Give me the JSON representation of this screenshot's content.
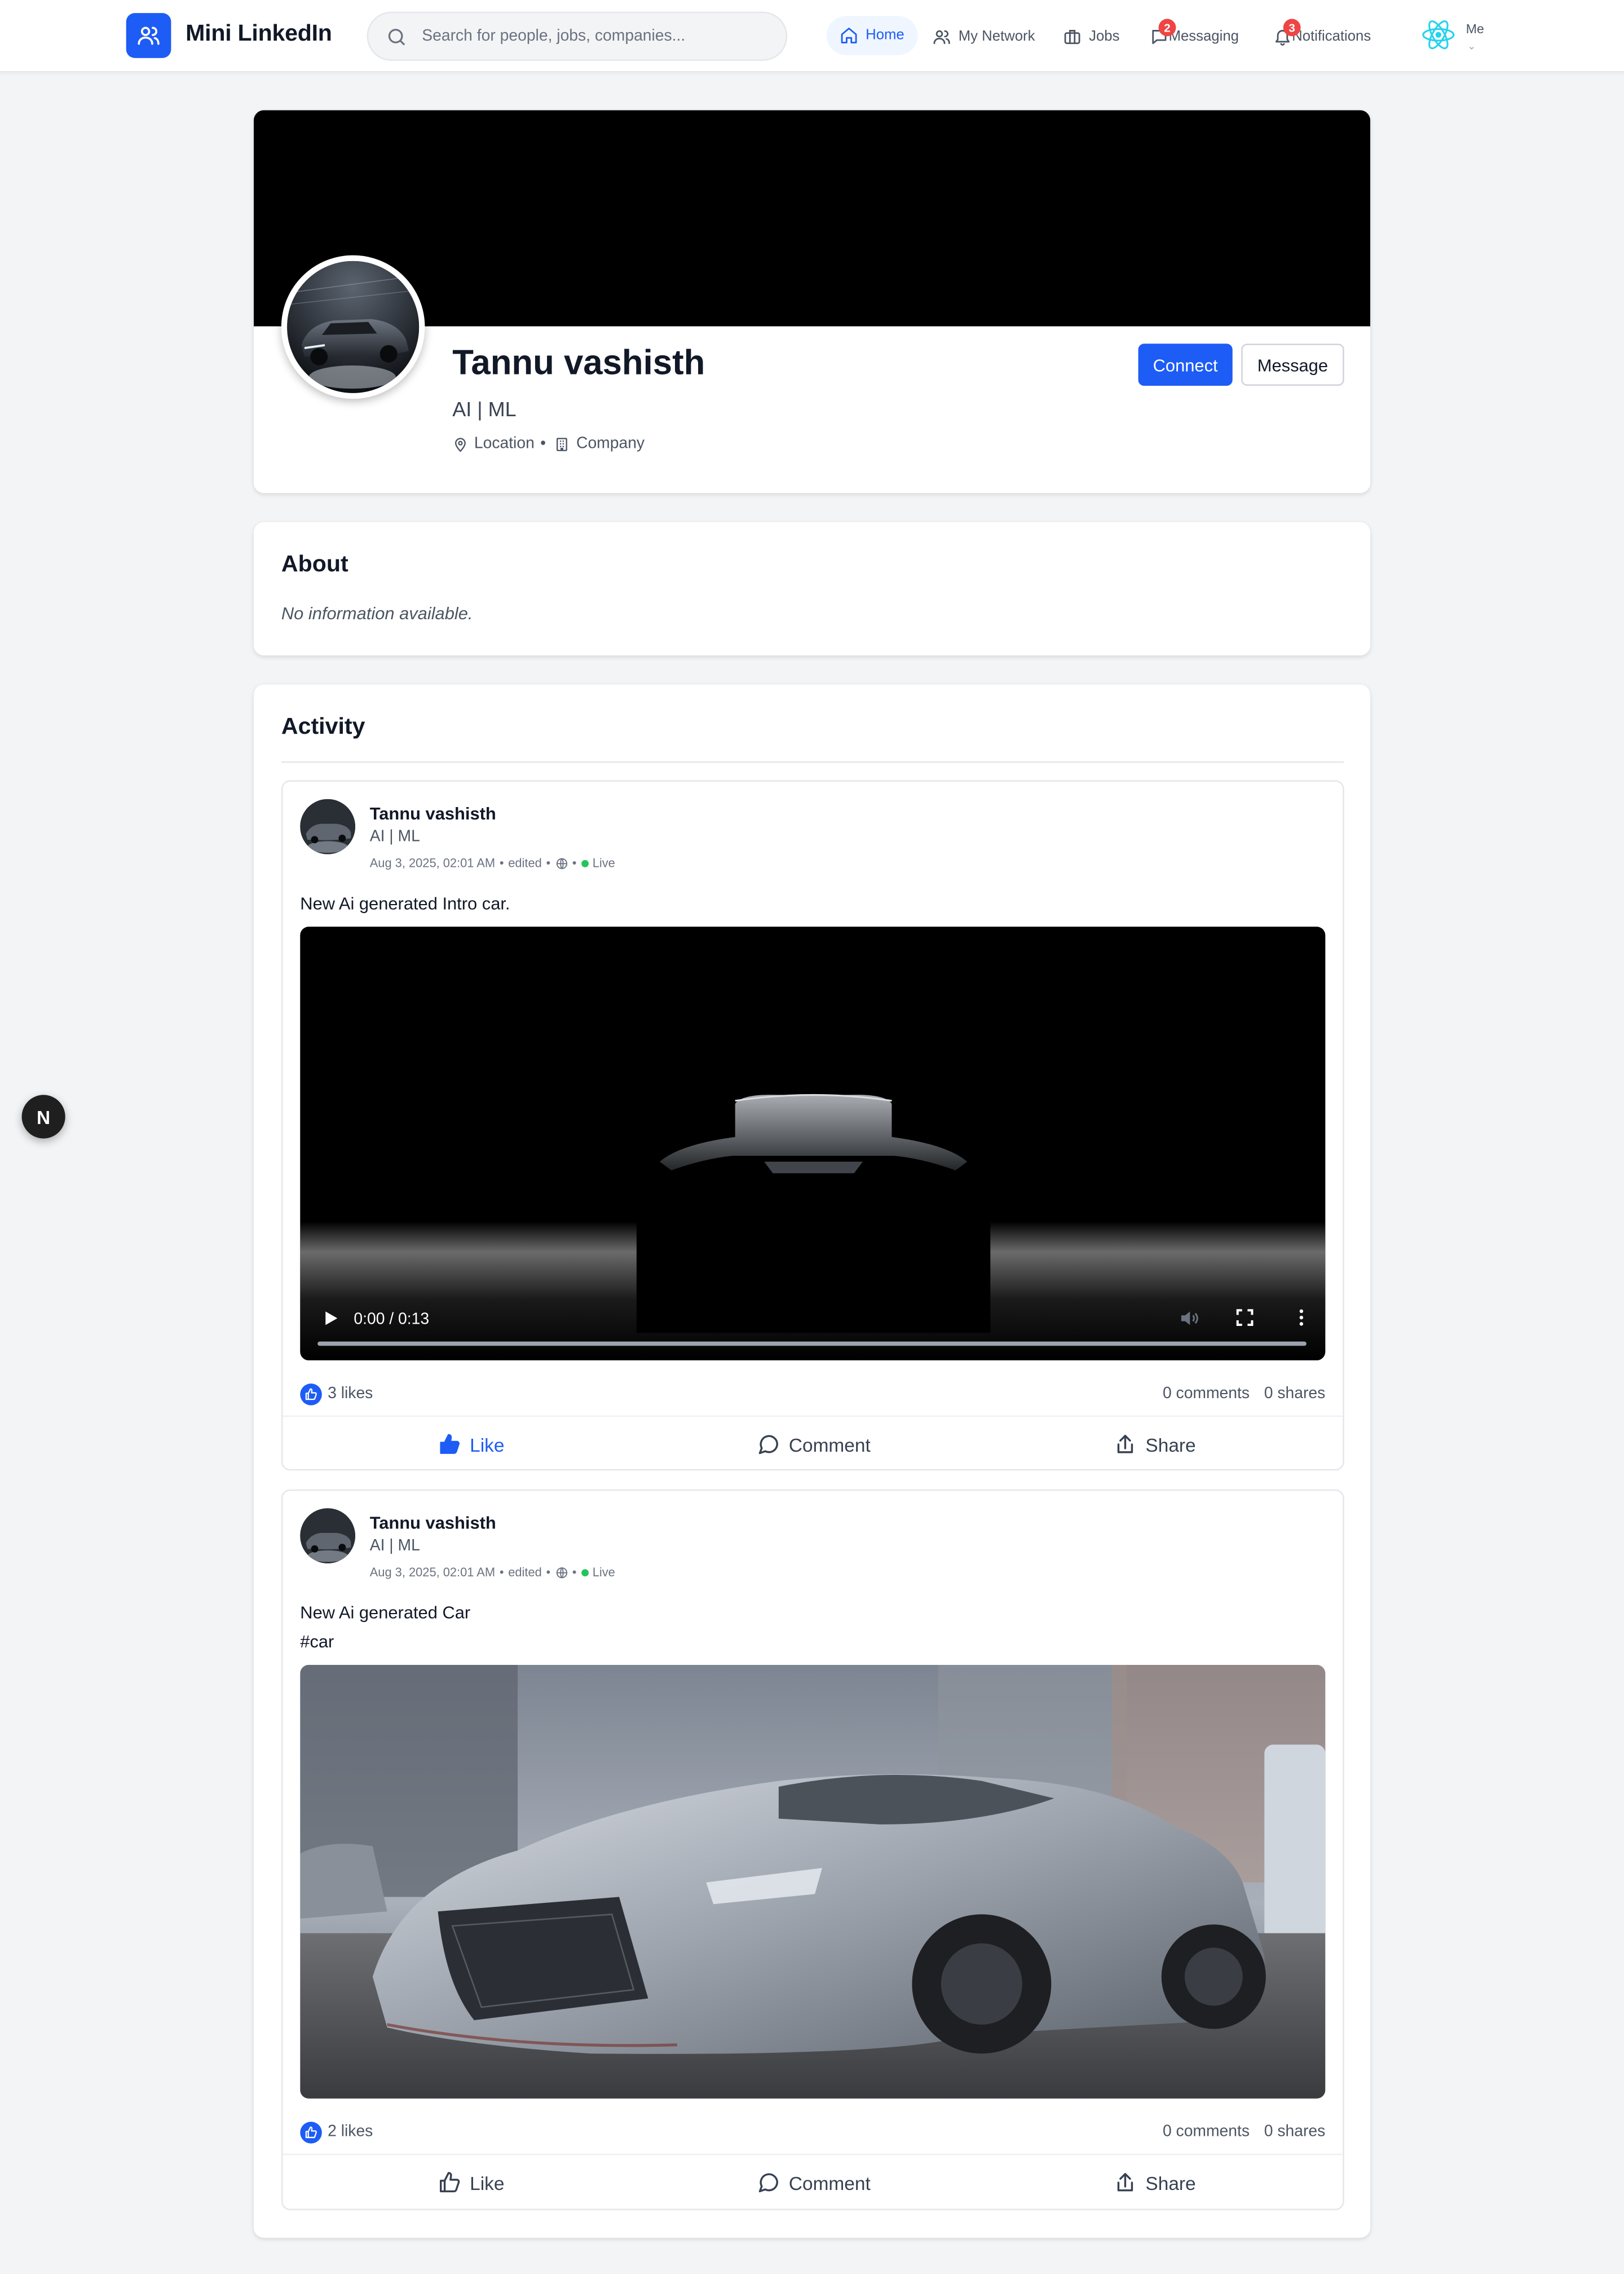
{
  "brand": {
    "name": "Mini LinkedIn",
    "logo_icon": "users-icon",
    "color": "#1d5cf5"
  },
  "search": {
    "placeholder": "Search for people, jobs, companies..."
  },
  "nav": {
    "home": "Home",
    "network": "My Network",
    "jobs": "Jobs",
    "messaging": "Messaging",
    "messaging_badge": "2",
    "notifications": "Notifications",
    "notifications_badge": "3",
    "me": "Me"
  },
  "profile": {
    "name": "Tannu vashisth",
    "headline": "AI | ML",
    "location": "Location",
    "company": "Company",
    "connect": "Connect",
    "message": "Message"
  },
  "about": {
    "title": "About",
    "text": "No information available."
  },
  "activity": {
    "title": "Activity",
    "posts": [
      {
        "author": "Tannu vashisth",
        "headline": "AI | ML",
        "date": "Aug 3, 2025, 02:01 AM",
        "edited": "edited",
        "status": "Live",
        "text_lines": [
          "New Ai generated Intro car."
        ],
        "media_type": "video",
        "video_time": "0:00 / 0:13",
        "likes": "3 likes",
        "comments": "0 comments",
        "shares": "0 shares",
        "liked": true
      },
      {
        "author": "Tannu vashisth",
        "headline": "AI | ML",
        "date": "Aug 3, 2025, 02:01 AM",
        "edited": "edited",
        "status": "Live",
        "text_lines": [
          "New Ai generated Car",
          "#car"
        ],
        "media_type": "image",
        "likes": "2 likes",
        "comments": "0 comments",
        "shares": "0 shares",
        "liked": false
      }
    ],
    "actions": {
      "like": "Like",
      "comment": "Comment",
      "share": "Share"
    }
  },
  "dev_badge": "N"
}
